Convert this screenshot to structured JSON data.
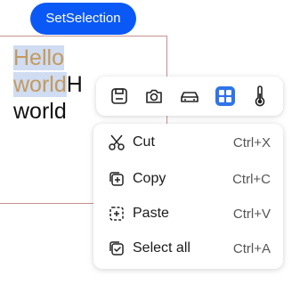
{
  "button": {
    "label": "SetSelection"
  },
  "editor": {
    "selected_text": "Hello world",
    "selected_line1": "Hello",
    "selected_line2": "world",
    "rest_inline": "H",
    "line3": "world"
  },
  "toolbar": {
    "icons": [
      "save-icon",
      "camera-icon",
      "car-icon",
      "grid-apps-icon",
      "thermometer-icon"
    ]
  },
  "context_menu": {
    "items": [
      {
        "label": "Cut",
        "shortcut": "Ctrl+X",
        "icon": "scissors-icon"
      },
      {
        "label": "Copy",
        "shortcut": "Ctrl+C",
        "icon": "copy-icon"
      },
      {
        "label": "Paste",
        "shortcut": "Ctrl+V",
        "icon": "paste-icon"
      },
      {
        "label": "Select all",
        "shortcut": "Ctrl+A",
        "icon": "select-all-icon"
      }
    ]
  },
  "colors": {
    "button_blue": "#0a59f7",
    "selection_bg": "#cfdcf2",
    "selection_text": "#c59a5c",
    "box_border": "#c98f8f"
  }
}
